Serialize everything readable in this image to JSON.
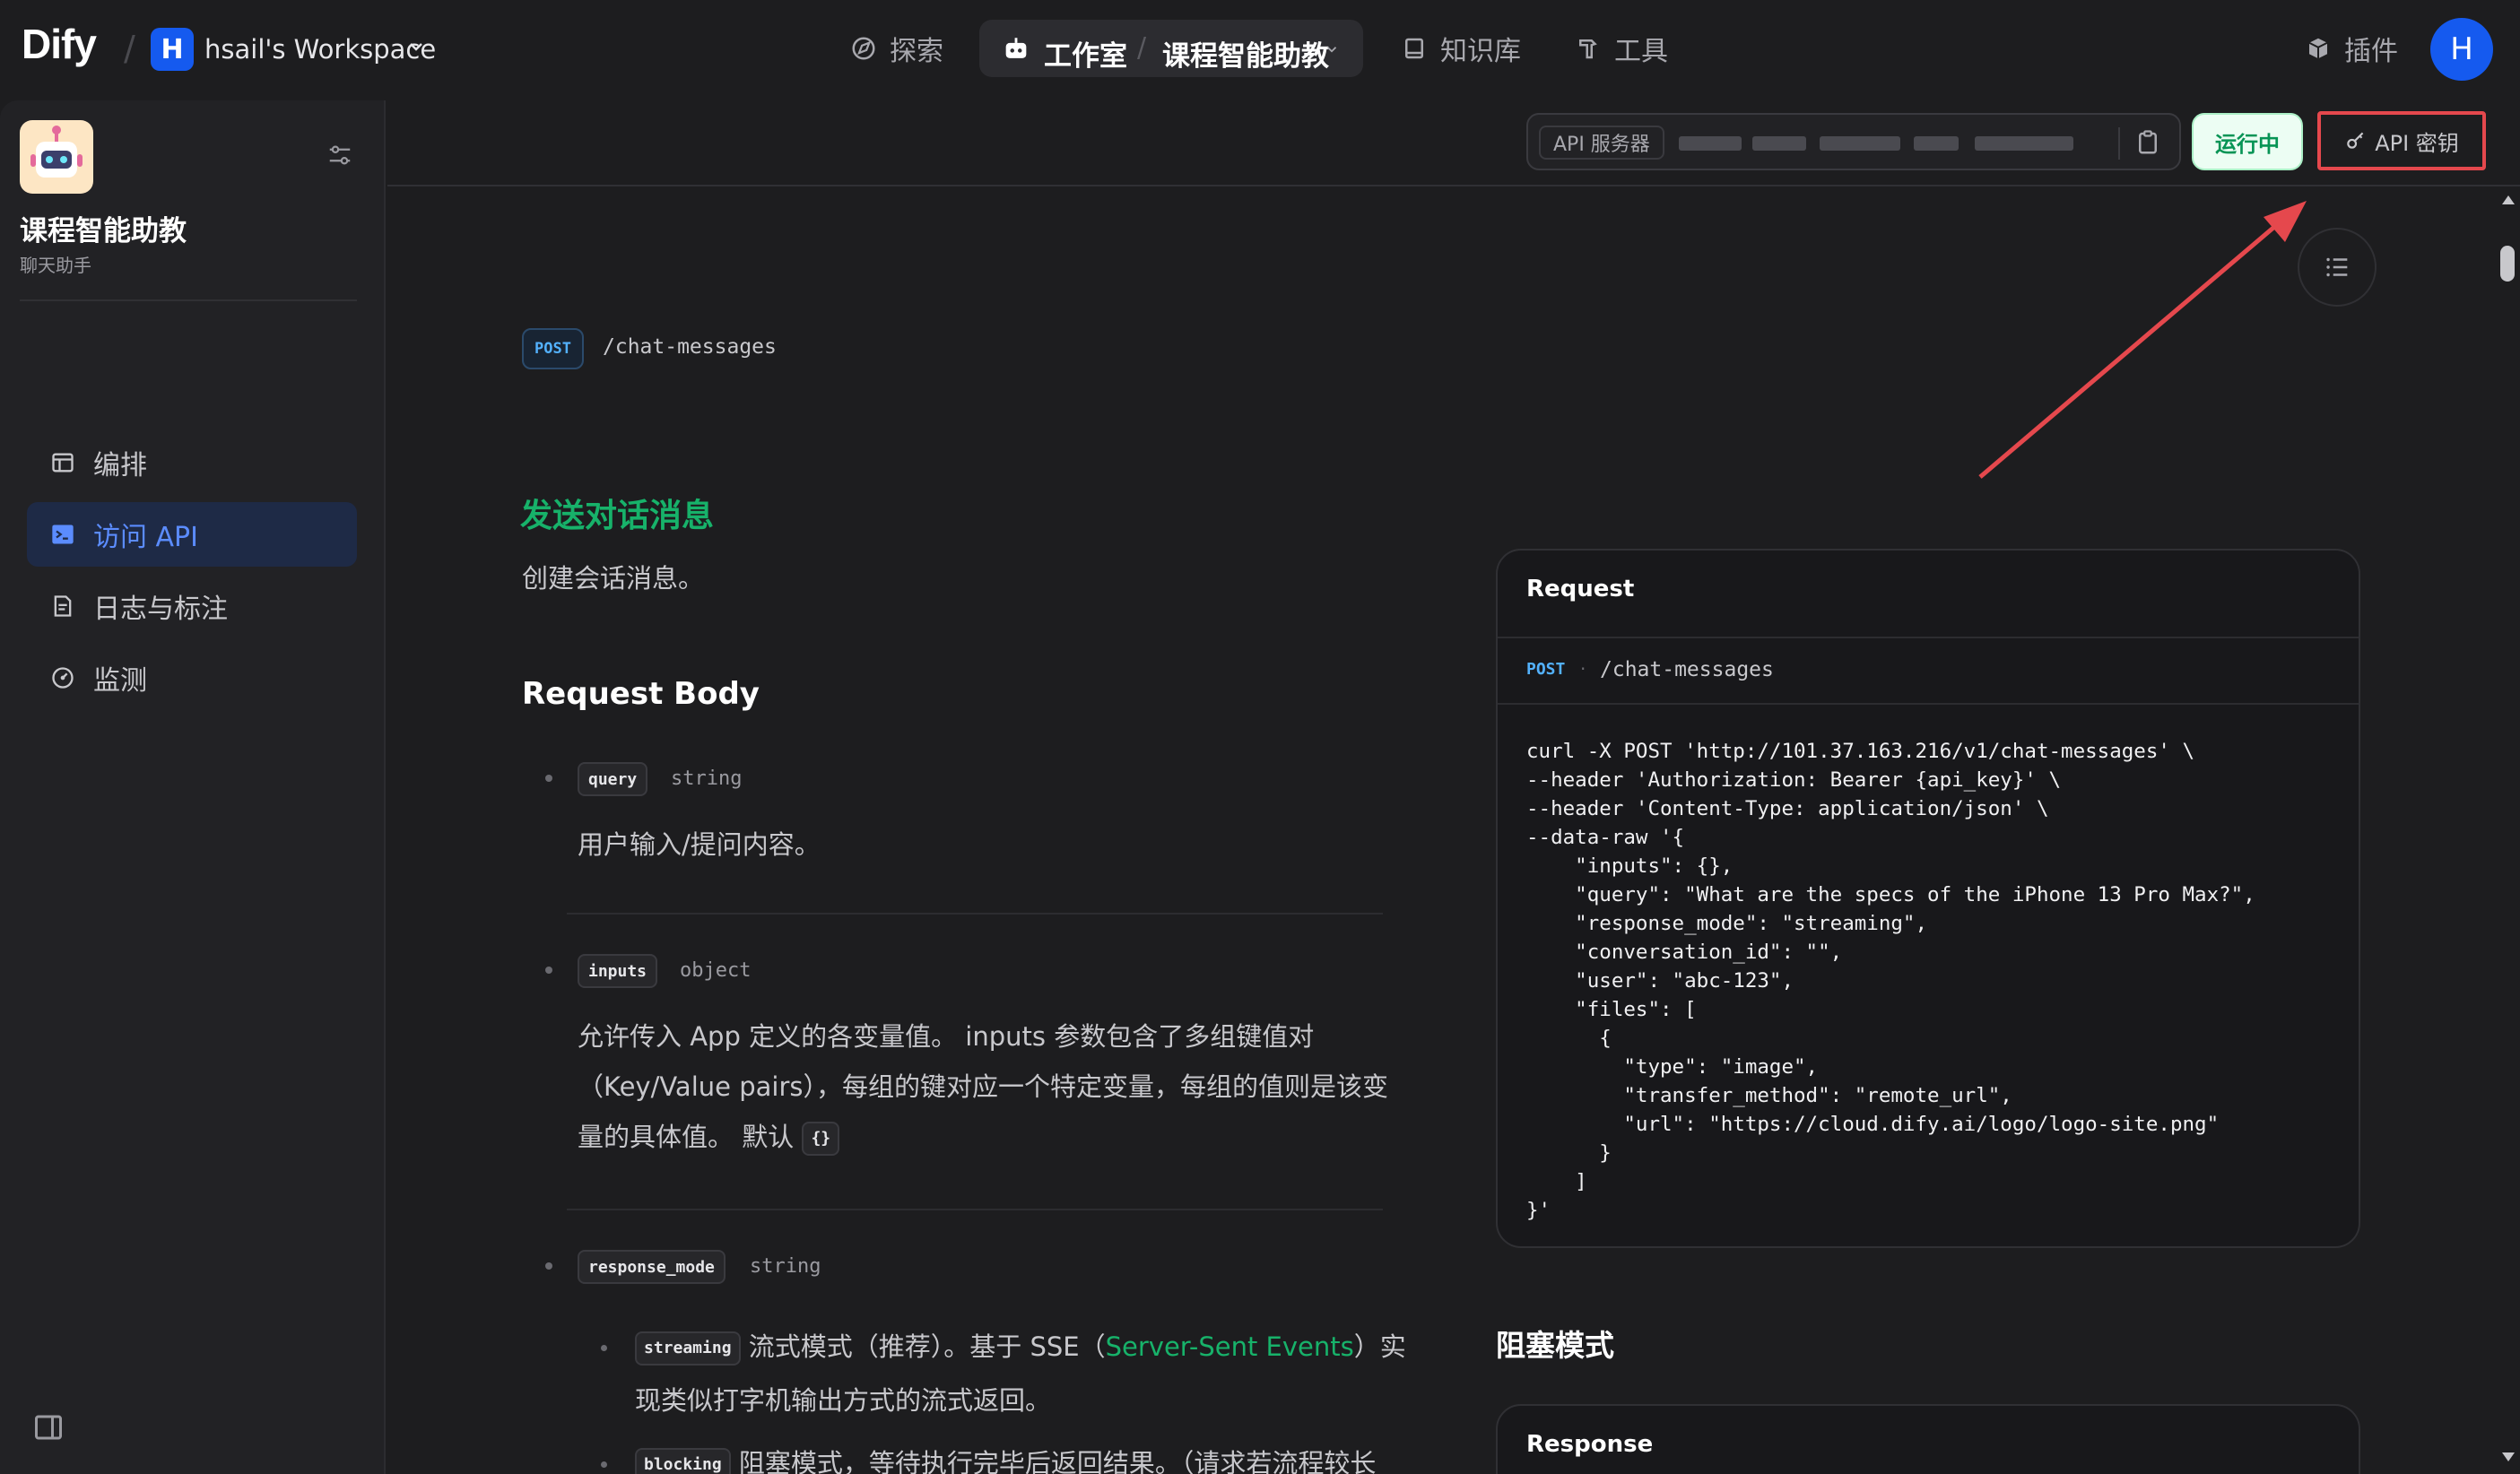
{
  "topbar": {
    "logo": "Dify",
    "workspace_initial": "H",
    "workspace_name": "hsail's Workspace",
    "nav": {
      "explore": "探索",
      "studio": "工作室",
      "app": "课程智能助教",
      "knowledge": "知识库",
      "tools": "工具",
      "plugins": "插件"
    },
    "avatar_initial": "H"
  },
  "sidebar": {
    "app_name": "课程智能助教",
    "app_type": "聊天助手",
    "items": [
      {
        "label": "编排",
        "icon": "layout-icon",
        "active": false
      },
      {
        "label": "访问 API",
        "icon": "terminal-icon",
        "active": true
      },
      {
        "label": "日志与标注",
        "icon": "file-list-icon",
        "active": false
      },
      {
        "label": "监测",
        "icon": "gauge-icon",
        "active": false
      }
    ]
  },
  "subbar": {
    "api_server_label": "API 服务器",
    "status": "运行中",
    "api_key_label": "API 密钥"
  },
  "doc": {
    "method": "POST",
    "endpoint": "/chat-messages",
    "title": "发送对话消息",
    "description": "创建会话消息。",
    "request_body_title": "Request Body",
    "params": {
      "query": {
        "name": "query",
        "type": "string",
        "desc": "用户输入/提问内容。"
      },
      "inputs": {
        "name": "inputs",
        "type": "object",
        "desc_line1": "允许传入 App 定义的各变量值。 inputs 参数包含了多组键值对",
        "desc_line2": "（Key/Value pairs），每组的键对应一个特定变量，每组的值则是该变",
        "desc_line3": "量的具体值。 默认",
        "default": "{}"
      },
      "response_mode": {
        "name": "response_mode",
        "type": "string",
        "streaming_tag": "streaming",
        "streaming_desc1": "流式模式（推荐）。基于 SSE（",
        "streaming_link": "Server-Sent Events",
        "streaming_desc2": "）实",
        "streaming_desc3": "现类似打字机输出方式的流式返回。",
        "blocking_tag": "blocking",
        "blocking_desc": "阻塞模式，等待执行完毕后返回结果。（请求若流程较长"
      }
    }
  },
  "request_panel": {
    "title": "Request",
    "method": "POST",
    "separator": "·",
    "path": "/chat-messages",
    "code": "curl -X POST 'http://101.37.163.216/v1/chat-messages' \\\n--header 'Authorization: Bearer {api_key}' \\\n--header 'Content-Type: application/json' \\\n--data-raw '{\n    \"inputs\": {},\n    \"query\": \"What are the specs of the iPhone 13 Pro Max?\",\n    \"response_mode\": \"streaming\",\n    \"conversation_id\": \"\",\n    \"user\": \"abc-123\",\n    \"files\": [\n      {\n        \"type\": \"image\",\n        \"transfer_method\": \"remote_url\",\n        \"url\": \"https://cloud.dify.ai/logo/logo-site.png\"\n      }\n    ]\n}'"
  },
  "blocking_section_title": "阻塞模式",
  "response_panel": {
    "title": "Response"
  },
  "colors": {
    "accent": "#155aef",
    "success": "#17b26a",
    "highlight": "#e5484d"
  }
}
